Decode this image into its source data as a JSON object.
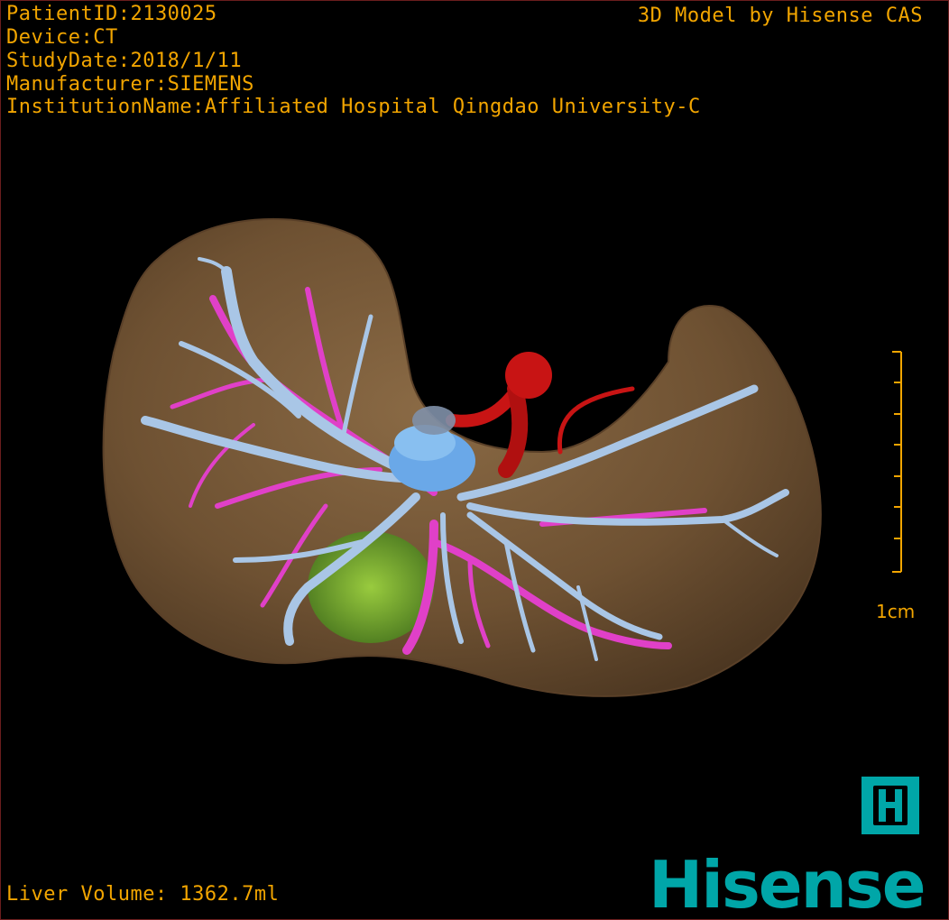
{
  "header": {
    "patient_id": "PatientID:2130025",
    "device": "Device:CT",
    "study_date": "StudyDate:2018/1/11",
    "manufacturer": "Manufacturer:SIEMENS",
    "institution": "InstitutionName:Affiliated Hospital Qingdao University-C",
    "credit": "3D Model by Hisense CAS"
  },
  "footer": {
    "liver_volume": "Liver Volume: 1362.7ml",
    "brand": "Hisense",
    "brand_mark": "H"
  },
  "scale_bar": {
    "label": "1cm"
  },
  "colors": {
    "text": "#f2a500",
    "liver": "#7a5a3a",
    "portal_vein": "#a9c6e6",
    "hepatic_vein": "#e040c8",
    "artery": "#c81414",
    "lesion": "#7cc83a",
    "brand": "#00a6a8"
  }
}
